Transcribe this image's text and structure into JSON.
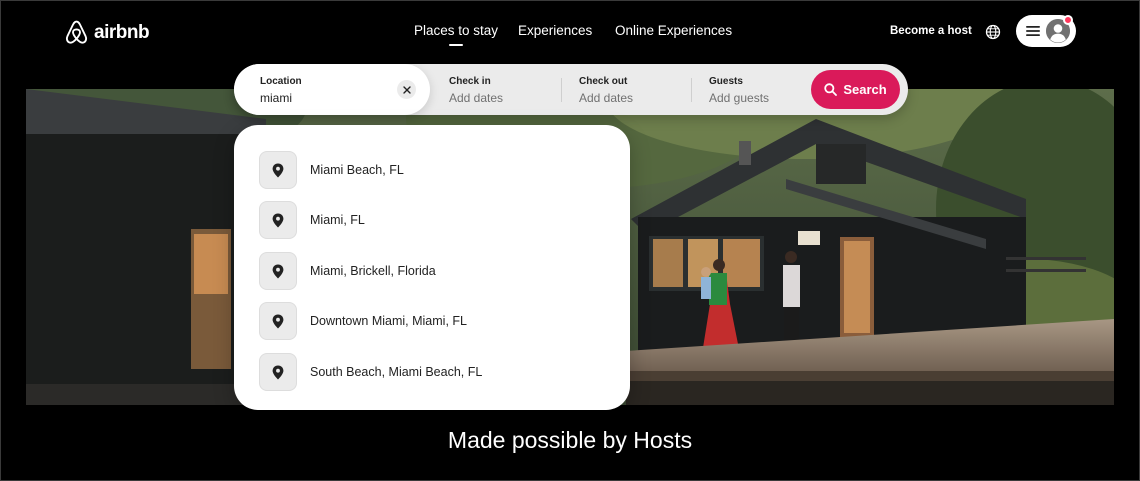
{
  "brand": {
    "name": "airbnb"
  },
  "nav": {
    "tabs": [
      {
        "label": "Places to stay",
        "active": true
      },
      {
        "label": "Experiences",
        "active": false
      },
      {
        "label": "Online Experiences",
        "active": false
      }
    ]
  },
  "header": {
    "become_host": "Become a host",
    "globe_icon": "globe-icon",
    "menu_icon": "hamburger-menu-icon",
    "avatar_icon": "user-avatar-icon",
    "notification": true
  },
  "search": {
    "location": {
      "label": "Location",
      "value": "miami"
    },
    "check_in": {
      "label": "Check in",
      "placeholder": "Add dates"
    },
    "check_out": {
      "label": "Check out",
      "placeholder": "Add dates"
    },
    "guests": {
      "label": "Guests",
      "placeholder": "Add guests"
    },
    "button_label": "Search"
  },
  "suggestions": [
    {
      "label": "Miami Beach, FL"
    },
    {
      "label": "Miami, FL"
    },
    {
      "label": "Miami, Brickell, Florida"
    },
    {
      "label": "Downtown Miami, Miami, FL"
    },
    {
      "label": "South Beach, Miami Beach, FL"
    }
  ],
  "hero": {
    "tagline": "Made possible by Hosts"
  },
  "colors": {
    "brand_accent": "#da1a5a",
    "notification": "#ff385c",
    "background": "#000000"
  }
}
